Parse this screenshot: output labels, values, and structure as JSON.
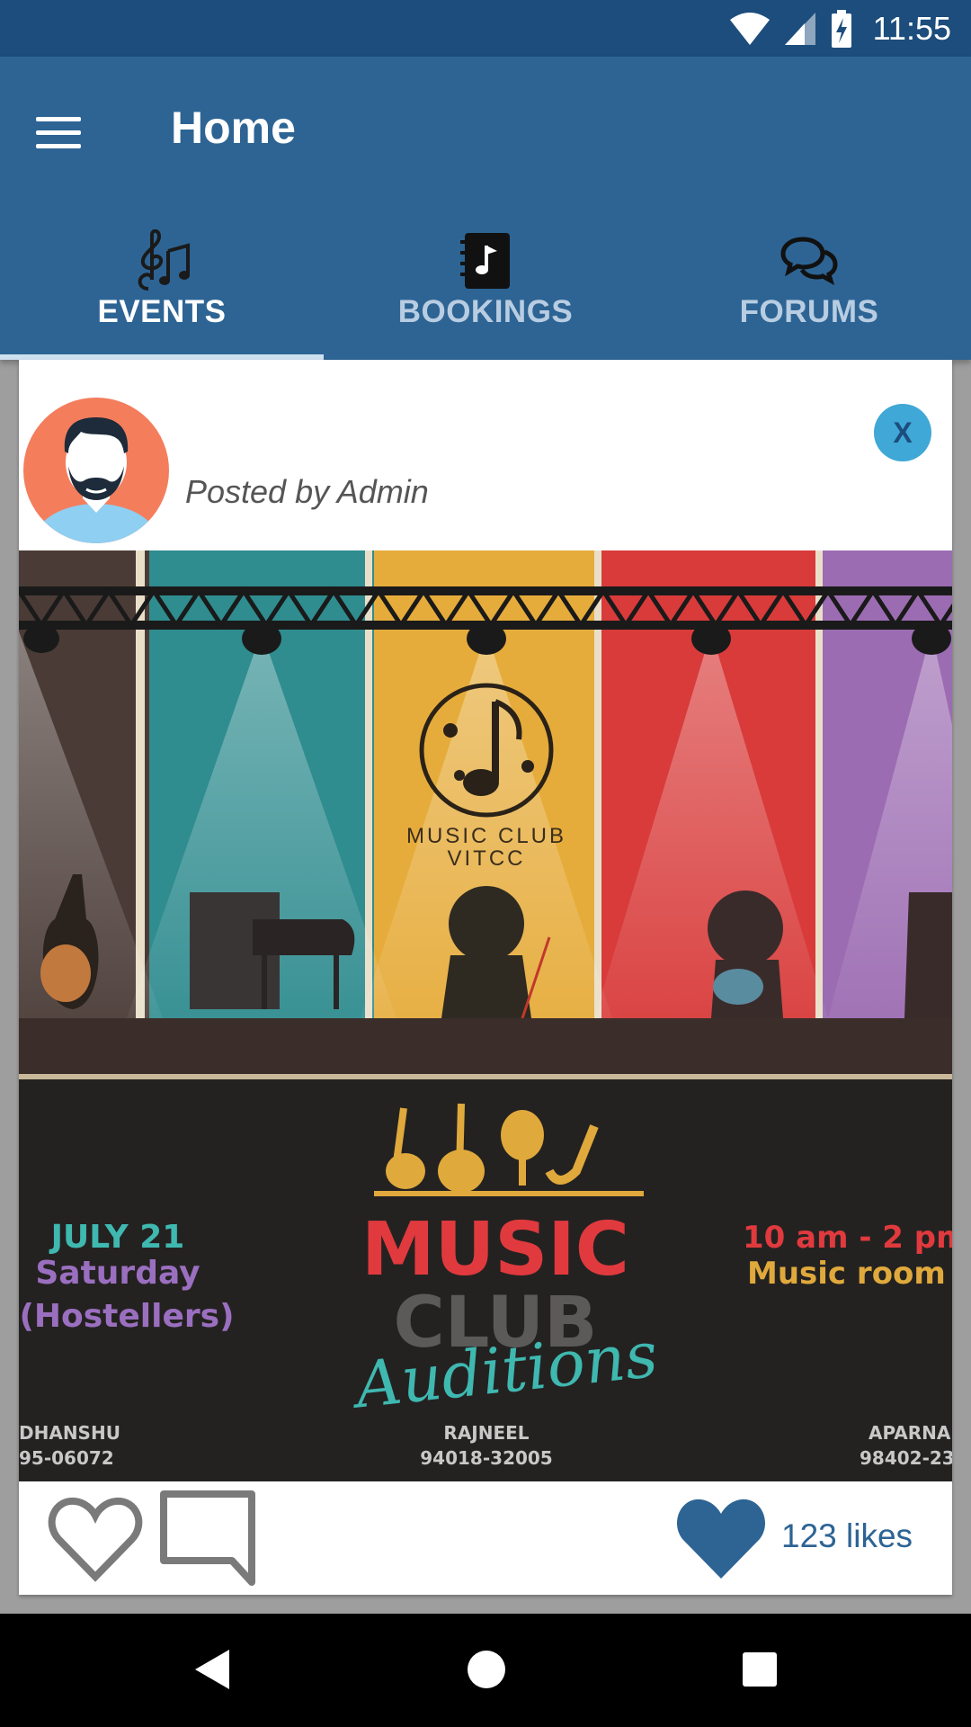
{
  "status_bar": {
    "time": "11:55",
    "icons": [
      "wifi-icon",
      "signal-icon",
      "battery-charging-icon"
    ]
  },
  "app_bar": {
    "title": "Home",
    "menu_icon": "hamburger-menu-icon"
  },
  "tabs": [
    {
      "label": "EVENTS",
      "icon": "music-notes-icon",
      "active": true
    },
    {
      "label": "BOOKINGS",
      "icon": "music-book-icon",
      "active": false
    },
    {
      "label": "FORUMS",
      "icon": "chat-bubbles-icon",
      "active": false
    }
  ],
  "post": {
    "posted_by": "Posted by Admin",
    "close_label": "X",
    "poster": {
      "logo_text_1": "MUSIC CLUB",
      "logo_text_2": "VITCC",
      "date": "JULY 21",
      "day": "Saturday",
      "audience": "(Hostellers)",
      "time": "10 am - 2 pm",
      "venue": "Music room",
      "headline_1": "MUSIC",
      "headline_2": "CLUB",
      "headline_3": "Auditions",
      "contacts": [
        {
          "name": "DHANSHU",
          "phone": "95-06072"
        },
        {
          "name": "RAJNEEL",
          "phone": "94018-32005"
        },
        {
          "name": "APARNA",
          "phone": "98402-23"
        }
      ]
    },
    "likes": "123 likes"
  },
  "colors": {
    "primary": "#2d6494",
    "status_bar": "#1c4d7c",
    "accent": "#3fa8d6"
  }
}
